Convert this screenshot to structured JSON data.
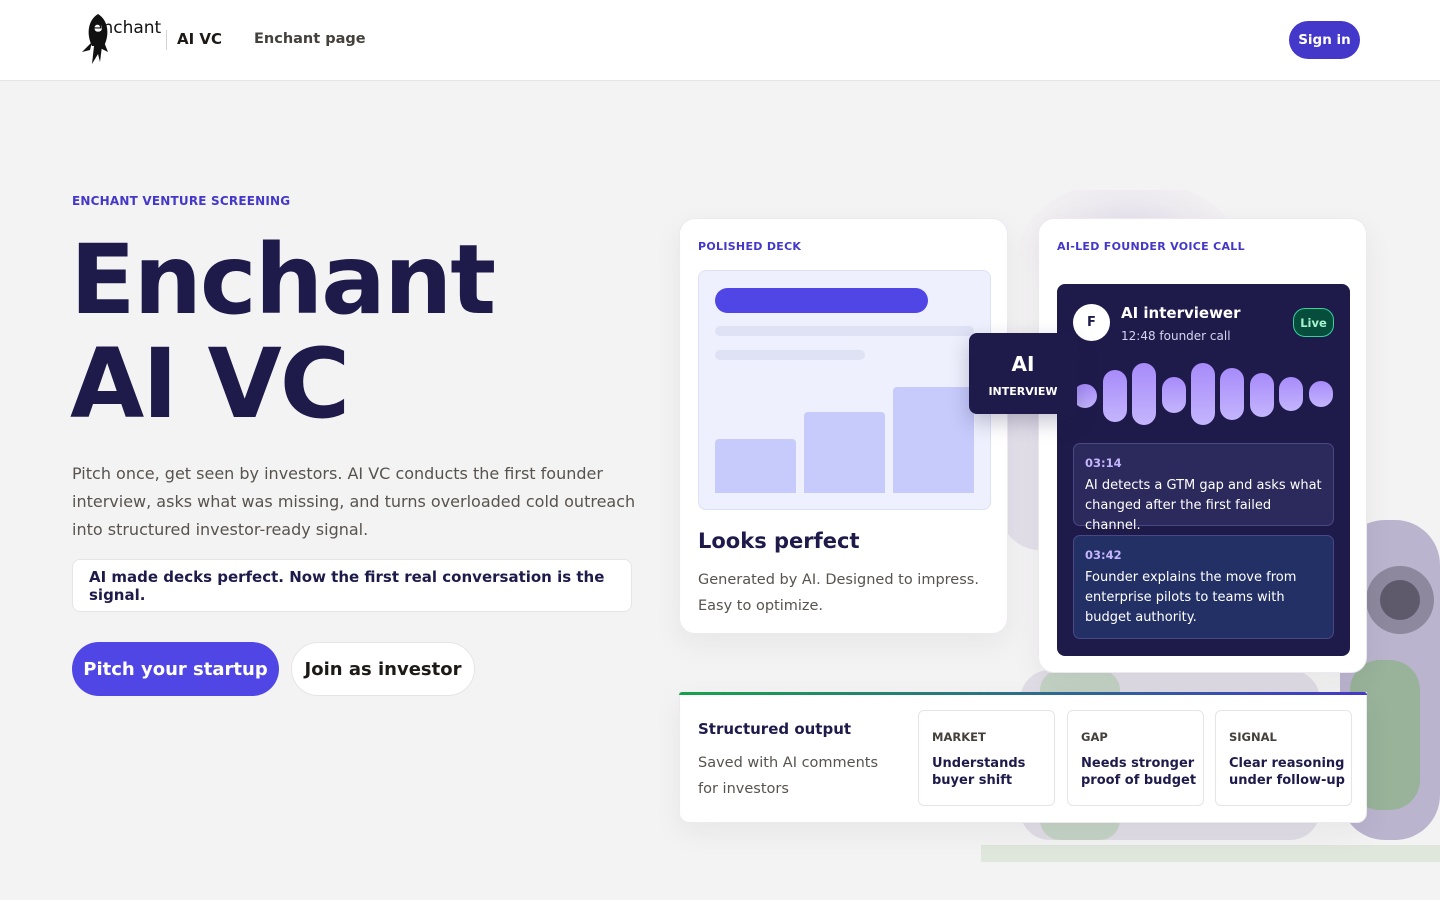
{
  "header": {
    "logo_word": "enchant",
    "brand_sub": "AI VC",
    "nav_link": "Enchant page",
    "signin_label": "Sign in"
  },
  "hero": {
    "eyebrow": "ENCHANT VENTURE SCREENING",
    "title_line1": "Enchant",
    "title_line2": "AI VC",
    "description": "Pitch once, get seen by investors. AI VC conducts the first founder interview, asks what was missing, and turns overloaded cold outreach into structured investor-ready signal.",
    "tagline": "AI made decks perfect. Now the first real conversation is the signal.",
    "primary_cta": "Pitch your startup",
    "secondary_cta": "Join as investor"
  },
  "deck_card": {
    "label": "POLISHED DECK",
    "heading": "Looks perfect",
    "subtext": "Generated by AI. Designed to impress. Easy to optimize."
  },
  "ai_badge": {
    "big": "AI",
    "small": "INTERVIEW"
  },
  "voice_card": {
    "label": "AI-LED FOUNDER VOICE CALL",
    "avatar_initial": "F",
    "caller_name": "AI interviewer",
    "call_time": "12:48 founder call",
    "live_label": "Live",
    "transcript": [
      {
        "time": "03:14",
        "text": "AI detects a GTM gap and asks what changed after the first failed channel."
      },
      {
        "time": "03:42",
        "text": "Founder explains the move from enterprise pilots to teams with budget authority."
      }
    ]
  },
  "output_card": {
    "title": "Structured output",
    "subtext": "Saved with AI comments for investors",
    "items": [
      {
        "label": "MARKET",
        "text": "Understands buyer shift"
      },
      {
        "label": "GAP",
        "text": "Needs stronger proof of budget"
      },
      {
        "label": "SIGNAL",
        "text": "Clear reasoning under follow-up"
      }
    ]
  },
  "colors": {
    "brand_accent": "#4f46e5",
    "deep_navy": "#1e1b4b",
    "live_green": "#34d399"
  }
}
